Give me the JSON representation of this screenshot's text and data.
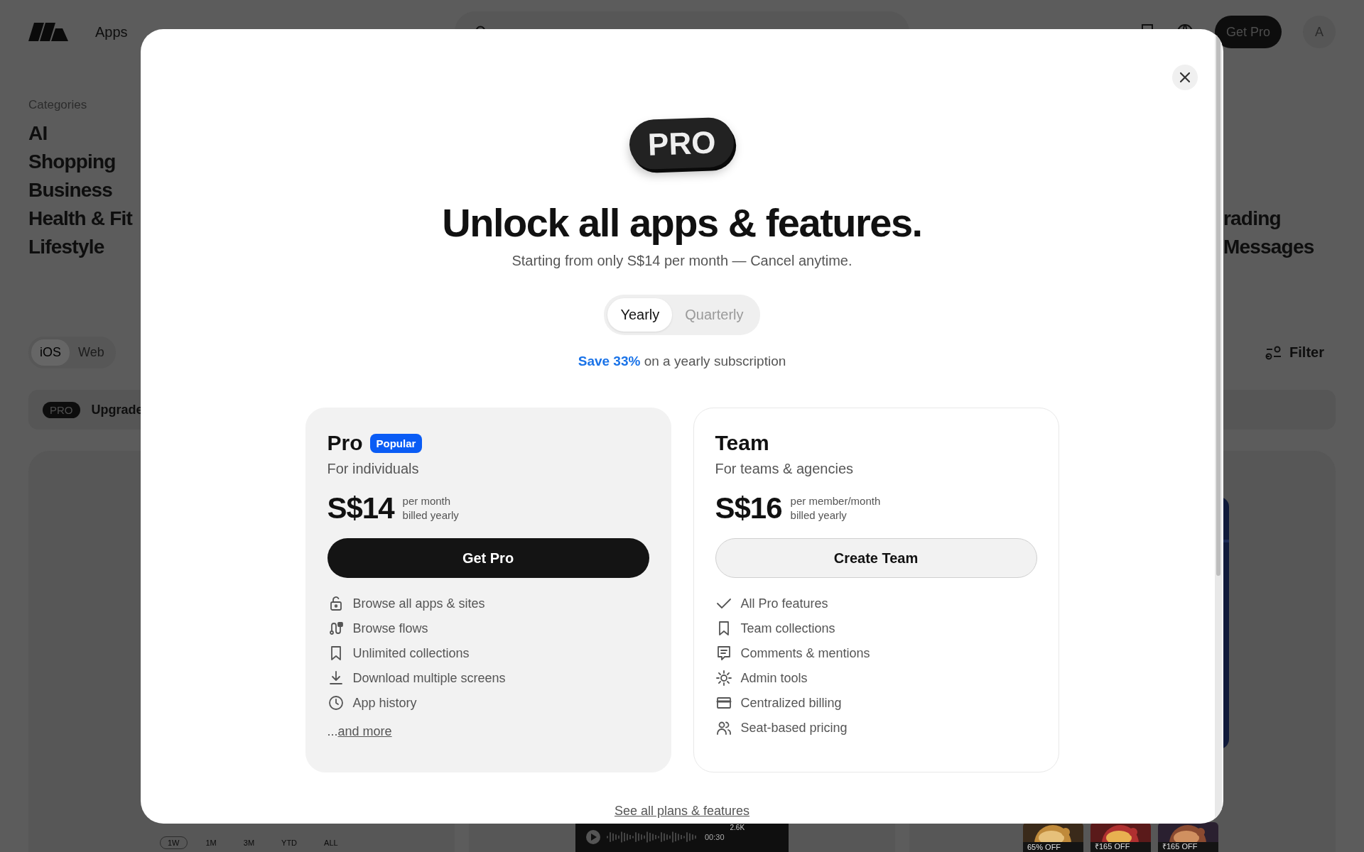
{
  "topbar": {
    "nav": [
      {
        "label": "Apps",
        "selected": true
      }
    ],
    "get_pro": "Get Pro",
    "avatar": "A"
  },
  "categories": {
    "label": "Categories",
    "items": [
      "AI",
      "Shopping",
      "Business",
      "Health & Fit",
      "Lifestyle"
    ],
    "items_right": [
      "rading",
      "Messages"
    ]
  },
  "platform_toggle": [
    {
      "label": "iOS",
      "selected": true
    },
    {
      "label": "Web",
      "selected": false
    }
  ],
  "filter": "Filter",
  "upgrade_banner": {
    "badge": "PRO",
    "text": "Upgrade"
  },
  "timeframes": [
    {
      "label": "1W",
      "selected": true
    },
    {
      "label": "1M",
      "selected": false
    },
    {
      "label": "3M",
      "selected": false
    },
    {
      "label": "YTD",
      "selected": false
    },
    {
      "label": "ALL",
      "selected": false
    }
  ],
  "audio": {
    "time": "00:30",
    "count": "2.6K"
  },
  "deals": [
    "65% OFF",
    "₹165 OFF",
    "₹165 OFF"
  ],
  "modal": {
    "badge": "PRO",
    "title": "Unlock all apps & features.",
    "subtitle": "Starting from only S$14 per month — Cancel anytime.",
    "billing": [
      {
        "label": "Yearly",
        "selected": true
      },
      {
        "label": "Quarterly",
        "selected": false
      }
    ],
    "savings": {
      "highlight": "Save 33%",
      "text": "on a yearly subscription"
    },
    "plans": [
      {
        "name": "Pro",
        "badge": "Popular",
        "highlighted": true,
        "subtitle": "For individuals",
        "price": "S$14",
        "price_note": [
          "per month",
          "billed yearly"
        ],
        "button": {
          "label": "Get Pro",
          "kind": "primary"
        },
        "features": [
          "Browse all apps & sites",
          "Browse flows",
          "Unlimited collections",
          "Download multiple screens",
          "App history"
        ],
        "more": {
          "prefix": "...",
          "link": "and more"
        }
      },
      {
        "name": "Team",
        "highlighted": false,
        "subtitle": "For teams & agencies",
        "price": "S$16",
        "price_note": [
          "per member/month",
          "billed yearly"
        ],
        "button": {
          "label": "Create Team",
          "kind": "secondary"
        },
        "features": [
          "All Pro features",
          "Team collections",
          "Comments & mentions",
          "Admin tools",
          "Centralized billing",
          "Seat-based pricing"
        ]
      }
    ],
    "footer_link": "See all plans & features"
  }
}
